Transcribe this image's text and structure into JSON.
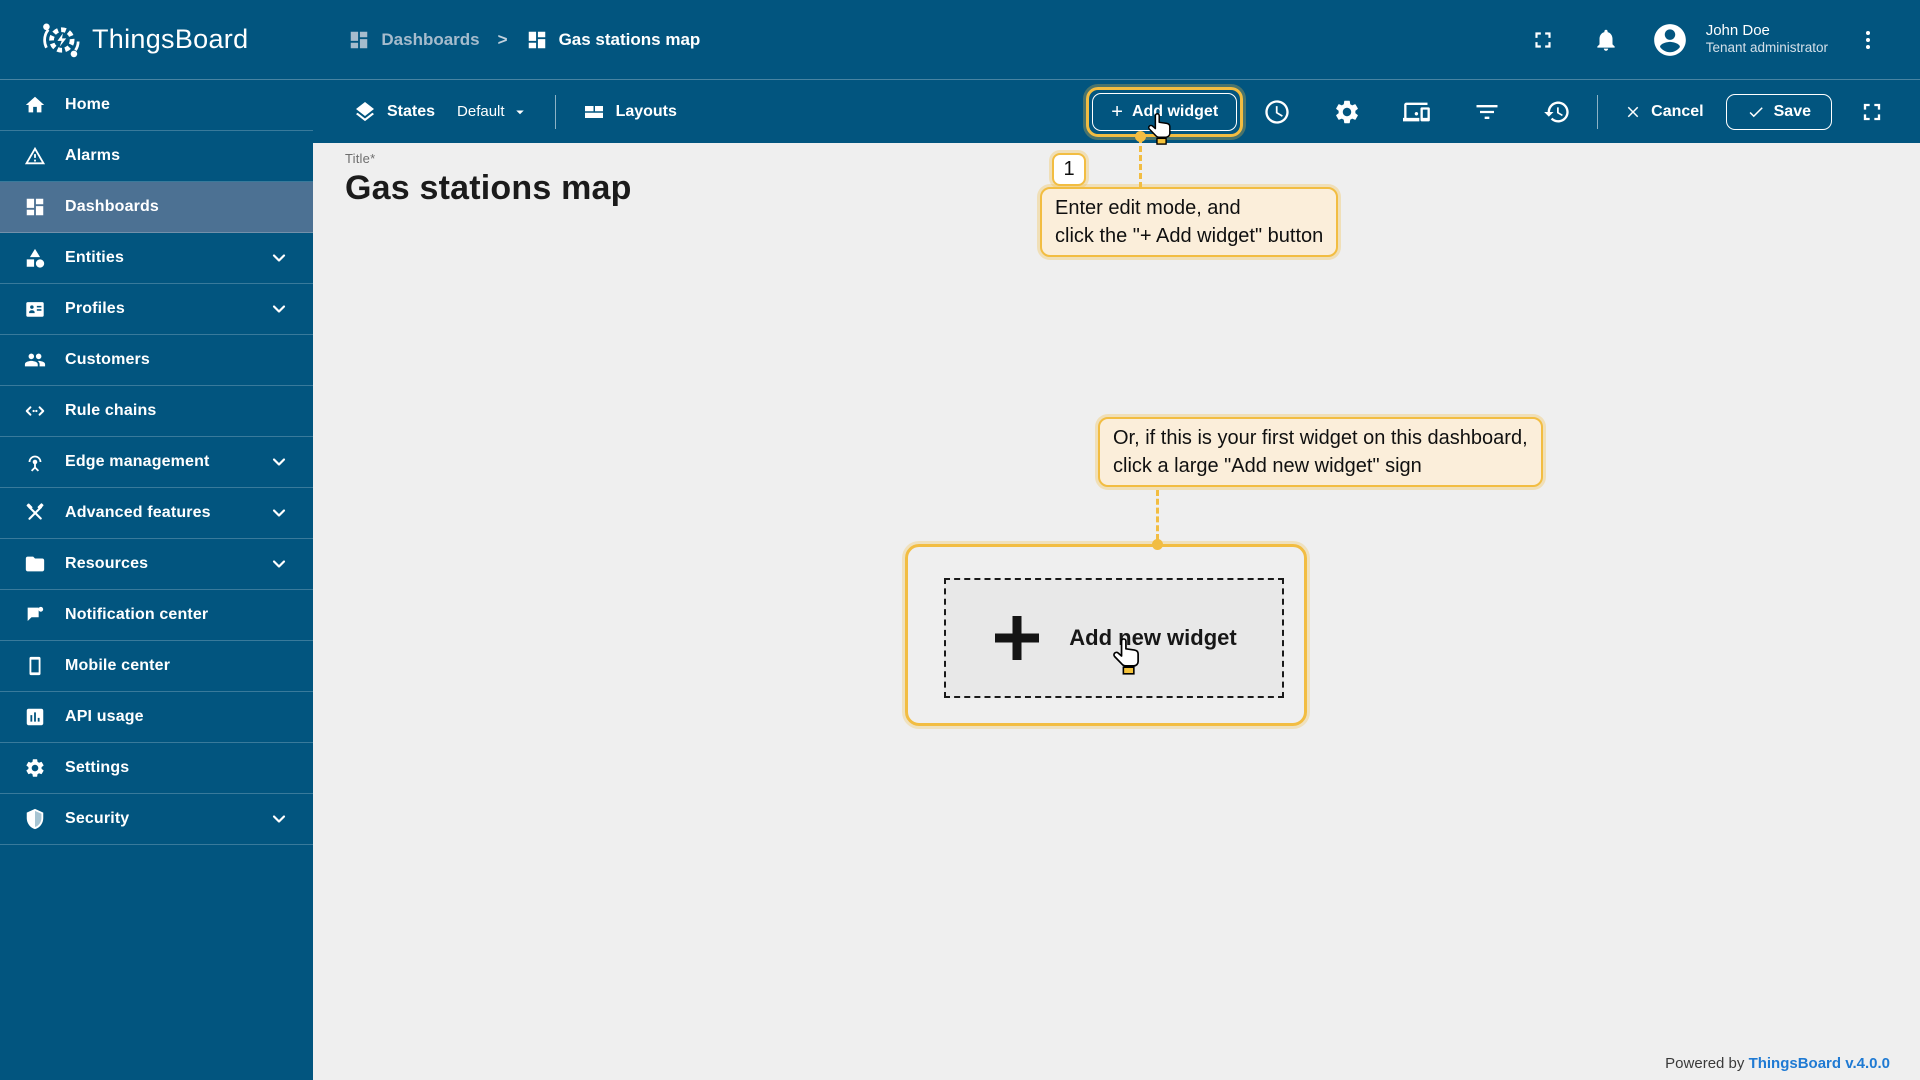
{
  "header": {
    "app_name": "ThingsBoard",
    "breadcrumb_separator": ">",
    "breadcrumb": [
      {
        "label": "Dashboards"
      },
      {
        "label": "Gas stations map"
      }
    ],
    "user": {
      "name": "John Doe",
      "role": "Tenant administrator"
    }
  },
  "toolbar": {
    "states_label": "States",
    "state_value": "Default",
    "layouts_label": "Layouts",
    "add_widget_plus": "+",
    "add_widget_label": "Add widget",
    "cancel_label": "Cancel",
    "save_label": "Save"
  },
  "sidebar": {
    "items": [
      {
        "label": "Home",
        "icon": "home",
        "expandable": false,
        "selected": false
      },
      {
        "label": "Alarms",
        "icon": "alarms",
        "expandable": false,
        "selected": false
      },
      {
        "label": "Dashboards",
        "icon": "dashboards",
        "expandable": false,
        "selected": true
      },
      {
        "label": "Entities",
        "icon": "entities",
        "expandable": true,
        "selected": false
      },
      {
        "label": "Profiles",
        "icon": "profiles",
        "expandable": true,
        "selected": false
      },
      {
        "label": "Customers",
        "icon": "customers",
        "expandable": false,
        "selected": false
      },
      {
        "label": "Rule chains",
        "icon": "rule-chains",
        "expandable": false,
        "selected": false
      },
      {
        "label": "Edge management",
        "icon": "edge-management",
        "expandable": true,
        "selected": false
      },
      {
        "label": "Advanced features",
        "icon": "advanced-features",
        "expandable": true,
        "selected": false
      },
      {
        "label": "Resources",
        "icon": "resources",
        "expandable": true,
        "selected": false
      },
      {
        "label": "Notification center",
        "icon": "notification-center",
        "expandable": false,
        "selected": false
      },
      {
        "label": "Mobile center",
        "icon": "mobile-center",
        "expandable": false,
        "selected": false
      },
      {
        "label": "API usage",
        "icon": "api-usage",
        "expandable": false,
        "selected": false
      },
      {
        "label": "Settings",
        "icon": "settings",
        "expandable": false,
        "selected": false
      },
      {
        "label": "Security",
        "icon": "security",
        "expandable": true,
        "selected": false
      }
    ]
  },
  "main": {
    "title_label": "Title*",
    "dashboard_title": "Gas stations map"
  },
  "tutorial": {
    "step_number": "1",
    "callout1_line1": "Enter edit mode, and",
    "callout1_line2": "click the \"+ Add widget\" button",
    "callout2_line1": "Or, if this is your first widget on this dashboard,",
    "callout2_line2": "click a large \"Add new widget\" sign",
    "add_sign_label": "Add new widget"
  },
  "footer": {
    "powered_by": "Powered by",
    "version_link": "ThingsBoard v.4.0.0"
  },
  "colors": {
    "primary_blue": "#02557F",
    "selected_item": "#4C7193",
    "accent_orange": "#F2BD42",
    "callout_bg": "#FBEEDA",
    "content_bg": "#EFEFEF",
    "link_blue": "#1F7AD3"
  }
}
